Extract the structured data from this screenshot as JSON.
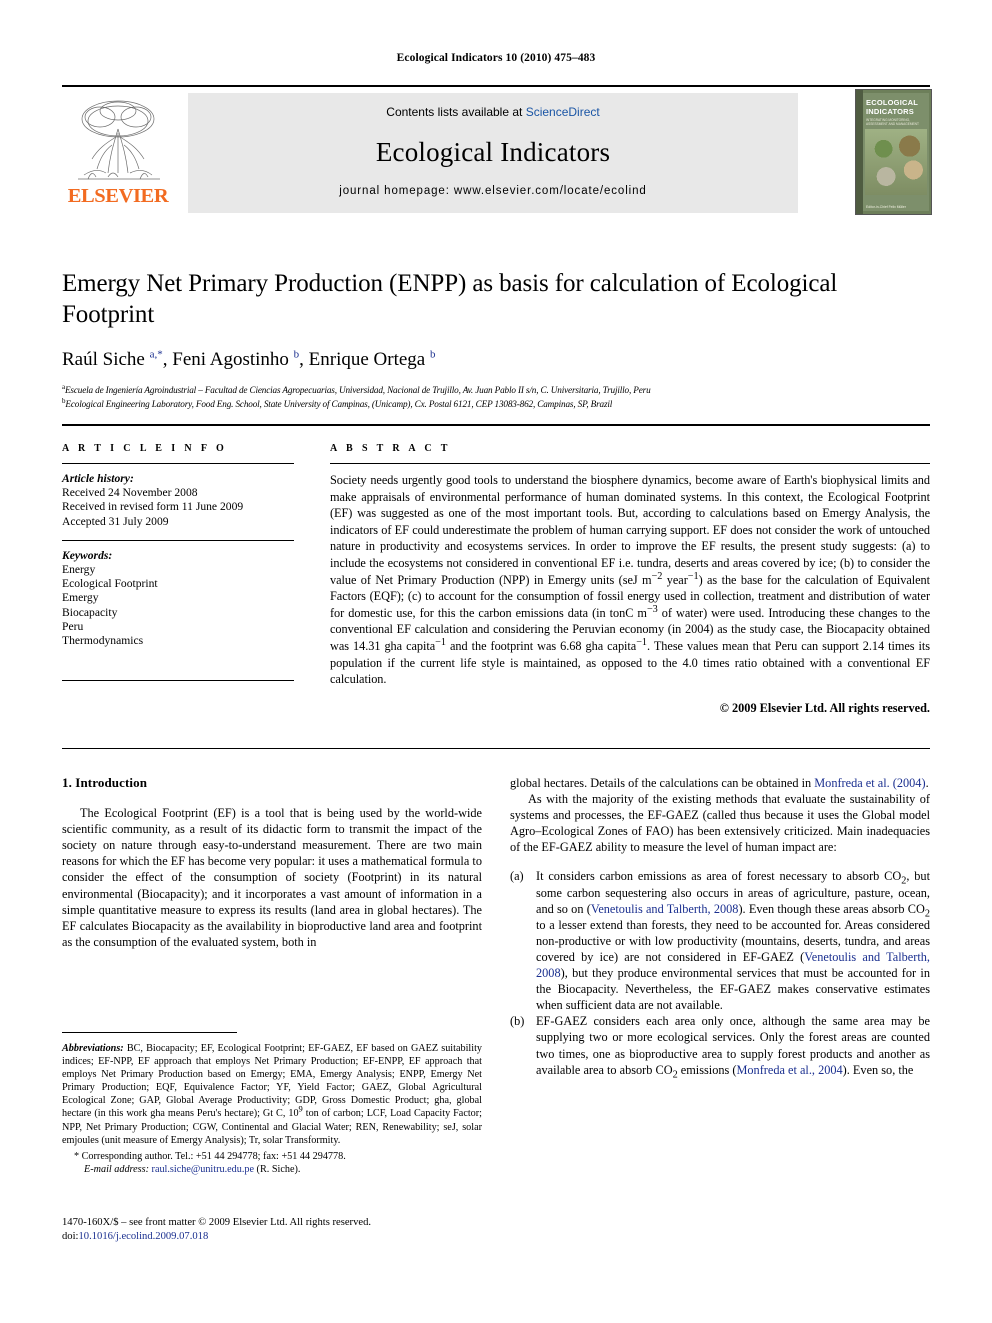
{
  "running_head": "Ecological Indicators 10 (2010) 475–483",
  "masthead": {
    "contents_prefix": "Contents lists available at ",
    "sciencedirect": "ScienceDirect",
    "journal_title": "Ecological Indicators",
    "homepage": "journal homepage: www.elsevier.com/locate/ecolind",
    "publisher": "ELSEVIER",
    "cover": {
      "title": "ECOLOGICAL INDICATORS",
      "subtitle": "INTEGRATING MONITORING, ASSESSMENT AND MANAGEMENT",
      "footer": "Editor-in-Chief\nFelix Müller"
    }
  },
  "article": {
    "title": "Emergy Net Primary Production (ENPP) as basis for calculation of Ecological Footprint",
    "authors_html": "Raúl Siche <sup>a,*</sup>, Feni Agostinho <sup>b</sup>, Enrique Ortega <sup>b</sup>",
    "affiliation_a": "Escuela de Ingeniería Agroindustrial – Facultad de Ciencias Agropecuarias, Universidad, Nacional de Trujillo, Av. Juan Pablo II s/n, C. Universitaria, Trujillo, Peru",
    "affiliation_b": "Ecological Engineering Laboratory, Food Eng. School, State University of Campinas, (Unicamp), Cx. Postal 6121, CEP 13083-862, Campinas, SP, Brazil"
  },
  "info": {
    "heading": "A R T I C L E  I N F O",
    "history_label": "Article history:",
    "history": [
      "Received 24 November 2008",
      "Received in revised form 11 June 2009",
      "Accepted 31 July 2009"
    ],
    "keywords_label": "Keywords:",
    "keywords": [
      "Energy",
      "Ecological Footprint",
      "Emergy",
      "Biocapacity",
      "Peru",
      "Thermodynamics"
    ]
  },
  "abstract": {
    "heading": "A B S T R A C T",
    "paragraph_1": "Society needs urgently good tools to understand the biosphere dynamics, become aware of Earth's biophysical limits and make appraisals of environmental performance of human dominated systems. In this context, the Ecological Footprint (EF) was suggested as one of the most important tools. But, according to calculations based on Emergy Analysis, the indicators of EF could underestimate the problem of human carrying support. EF does not consider the work of untouched nature in productivity and ecosystems services. In order to improve the EF results, the present study suggests: (a) to include the ecosystems not considered in conventional EF i.e. tundra, deserts and areas covered by ice; (b) to consider the value of Net Primary Production (NPP) in Emergy units (seJ m",
    "sup_1": "−2",
    "paragraph_1b": " year",
    "sup_2": "−1",
    "paragraph_1c": ") as the base for the calculation of Equivalent Factors (EQF); (c) to account for the consumption of fossil energy used in collection, treatment and distribution of water for domestic use, for this the carbon emissions data (in tonC m",
    "sup_3": "−3",
    "paragraph_1d": " of water) were used. Introducing these changes to the conventional EF calculation and considering the Peruvian economy (in 2004) as the study case, the Biocapacity obtained was 14.31 gha capita",
    "sup_4": "−1",
    "paragraph_1e": " and the footprint was 6.68 gha capita",
    "sup_5": "−1",
    "paragraph_1f": ". These values mean that Peru can support 2.14 times its population if the current life style is maintained, as opposed to the 4.0 times ratio obtained with a conventional EF calculation.",
    "copyright": "© 2009 Elsevier Ltd. All rights reserved."
  },
  "body": {
    "section_number_title": "1. Introduction",
    "left_p1": "The Ecological Footprint (EF) is a tool that is being used by the world-wide scientific community, as a result of its didactic form to transmit the impact of the society on nature through easy-to-understand measurement. There are two main reasons for which the EF has become very popular: it uses a mathematical formula to consider the effect of the consumption of society (Footprint) in its natural environmental (Biocapacity); and it incorporates a vast amount of information in a simple quantitative measure to express its results (land area in global hectares). The EF calculates Biocapacity as the availability in bioproductive land area and footprint as the consumption of the evaluated system, both in",
    "right_p1_a": "global hectares. Details of the calculations can be obtained in ",
    "right_p1_ref": "Monfreda et al. (2004)",
    "right_p1_b": ".",
    "right_p2": "As with the majority of the existing methods that evaluate the sustainability of systems and processes, the EF-GAEZ (called thus because it uses the Global model Agro–Ecological Zones of FAO) has been extensively criticized. Main inadequacies of the EF-GAEZ ability to measure the level of human impact are:",
    "list": [
      {
        "marker": "(a)",
        "t1": "It considers carbon emissions as area of forest necessary to absorb CO",
        "sub1": "2",
        "t2": ", but some carbon sequestering also occurs in areas of agriculture, pasture, ocean, and so on (",
        "ref1": "Venetoulis and Talberth, 2008",
        "t3": "). Even though these areas absorb CO",
        "sub2": "2",
        "t4": " to a lesser extend than forests, they need to be accounted for. Areas considered non-productive or with low productivity (mountains, deserts, tundra, and areas covered by ice) are not considered in EF-GAEZ (",
        "ref2": "Venetoulis and Talberth, 2008",
        "t5": "), but they produce environmental services that must be accounted for in the Biocapacity. Nevertheless, the EF-GAEZ makes conservative estimates when sufficient data are not available."
      },
      {
        "marker": "(b)",
        "t1": "EF-GAEZ considers each area only once, although the same area may be supplying two or more ecological services. Only the forest areas are counted two times, one as bioproductive area to supply forest products and another as available area to absorb CO",
        "sub1": "2",
        "t2": " emissions (",
        "ref1": "Monfreda et al., 2004",
        "t3": "). Even so, the"
      }
    ]
  },
  "footnotes": {
    "abbrev_label": "Abbreviations:",
    "abbrev_text_a": " BC, Biocapacity; EF, Ecological Footprint; EF-GAEZ, EF based on GAEZ suitability indices; EF-NPP, EF approach that employs Net Primary Production; EF-ENPP, EF approach that employs Net Primary Production based on Emergy; EMA, Emergy Analysis; ENPP, Emergy Net Primary Production; EQF, Equivalence Factor; YF, Yield Factor; GAEZ, Global Agricultural Ecological Zone; GAP, Global Average Productivity; GDP, Gross Domestic Product; gha, global hectare (in this work gha means Peru's hectare); Gt C, 10",
    "abbrev_sup": "9",
    "abbrev_text_b": " ton of carbon; LCF, Load Capacity Factor; NPP, Net Primary Production; CGW, Continental and Glacial Water; REN, Renewability; seJ, solar emjoules (unit measure of Emergy Analysis); Tr, solar Transformity.",
    "corresponding": "* Corresponding author. Tel.: +51 44 294778; fax: +51 44 294778.",
    "email_label": "E-mail address:",
    "email": "raul.siche@unitru.edu.pe",
    "email_suffix": " (R. Siche)."
  },
  "imprint": {
    "line1": "1470-160X/$ – see front matter © 2009 Elsevier Ltd. All rights reserved.",
    "doi_label": "doi:",
    "doi": "10.1016/j.ecolind.2009.07.018"
  },
  "colors": {
    "link": "#1a2f8f",
    "sciencedirect": "#1a55a5",
    "elsevier_orange": "#F26B21",
    "band": "#e8e8e8"
  }
}
